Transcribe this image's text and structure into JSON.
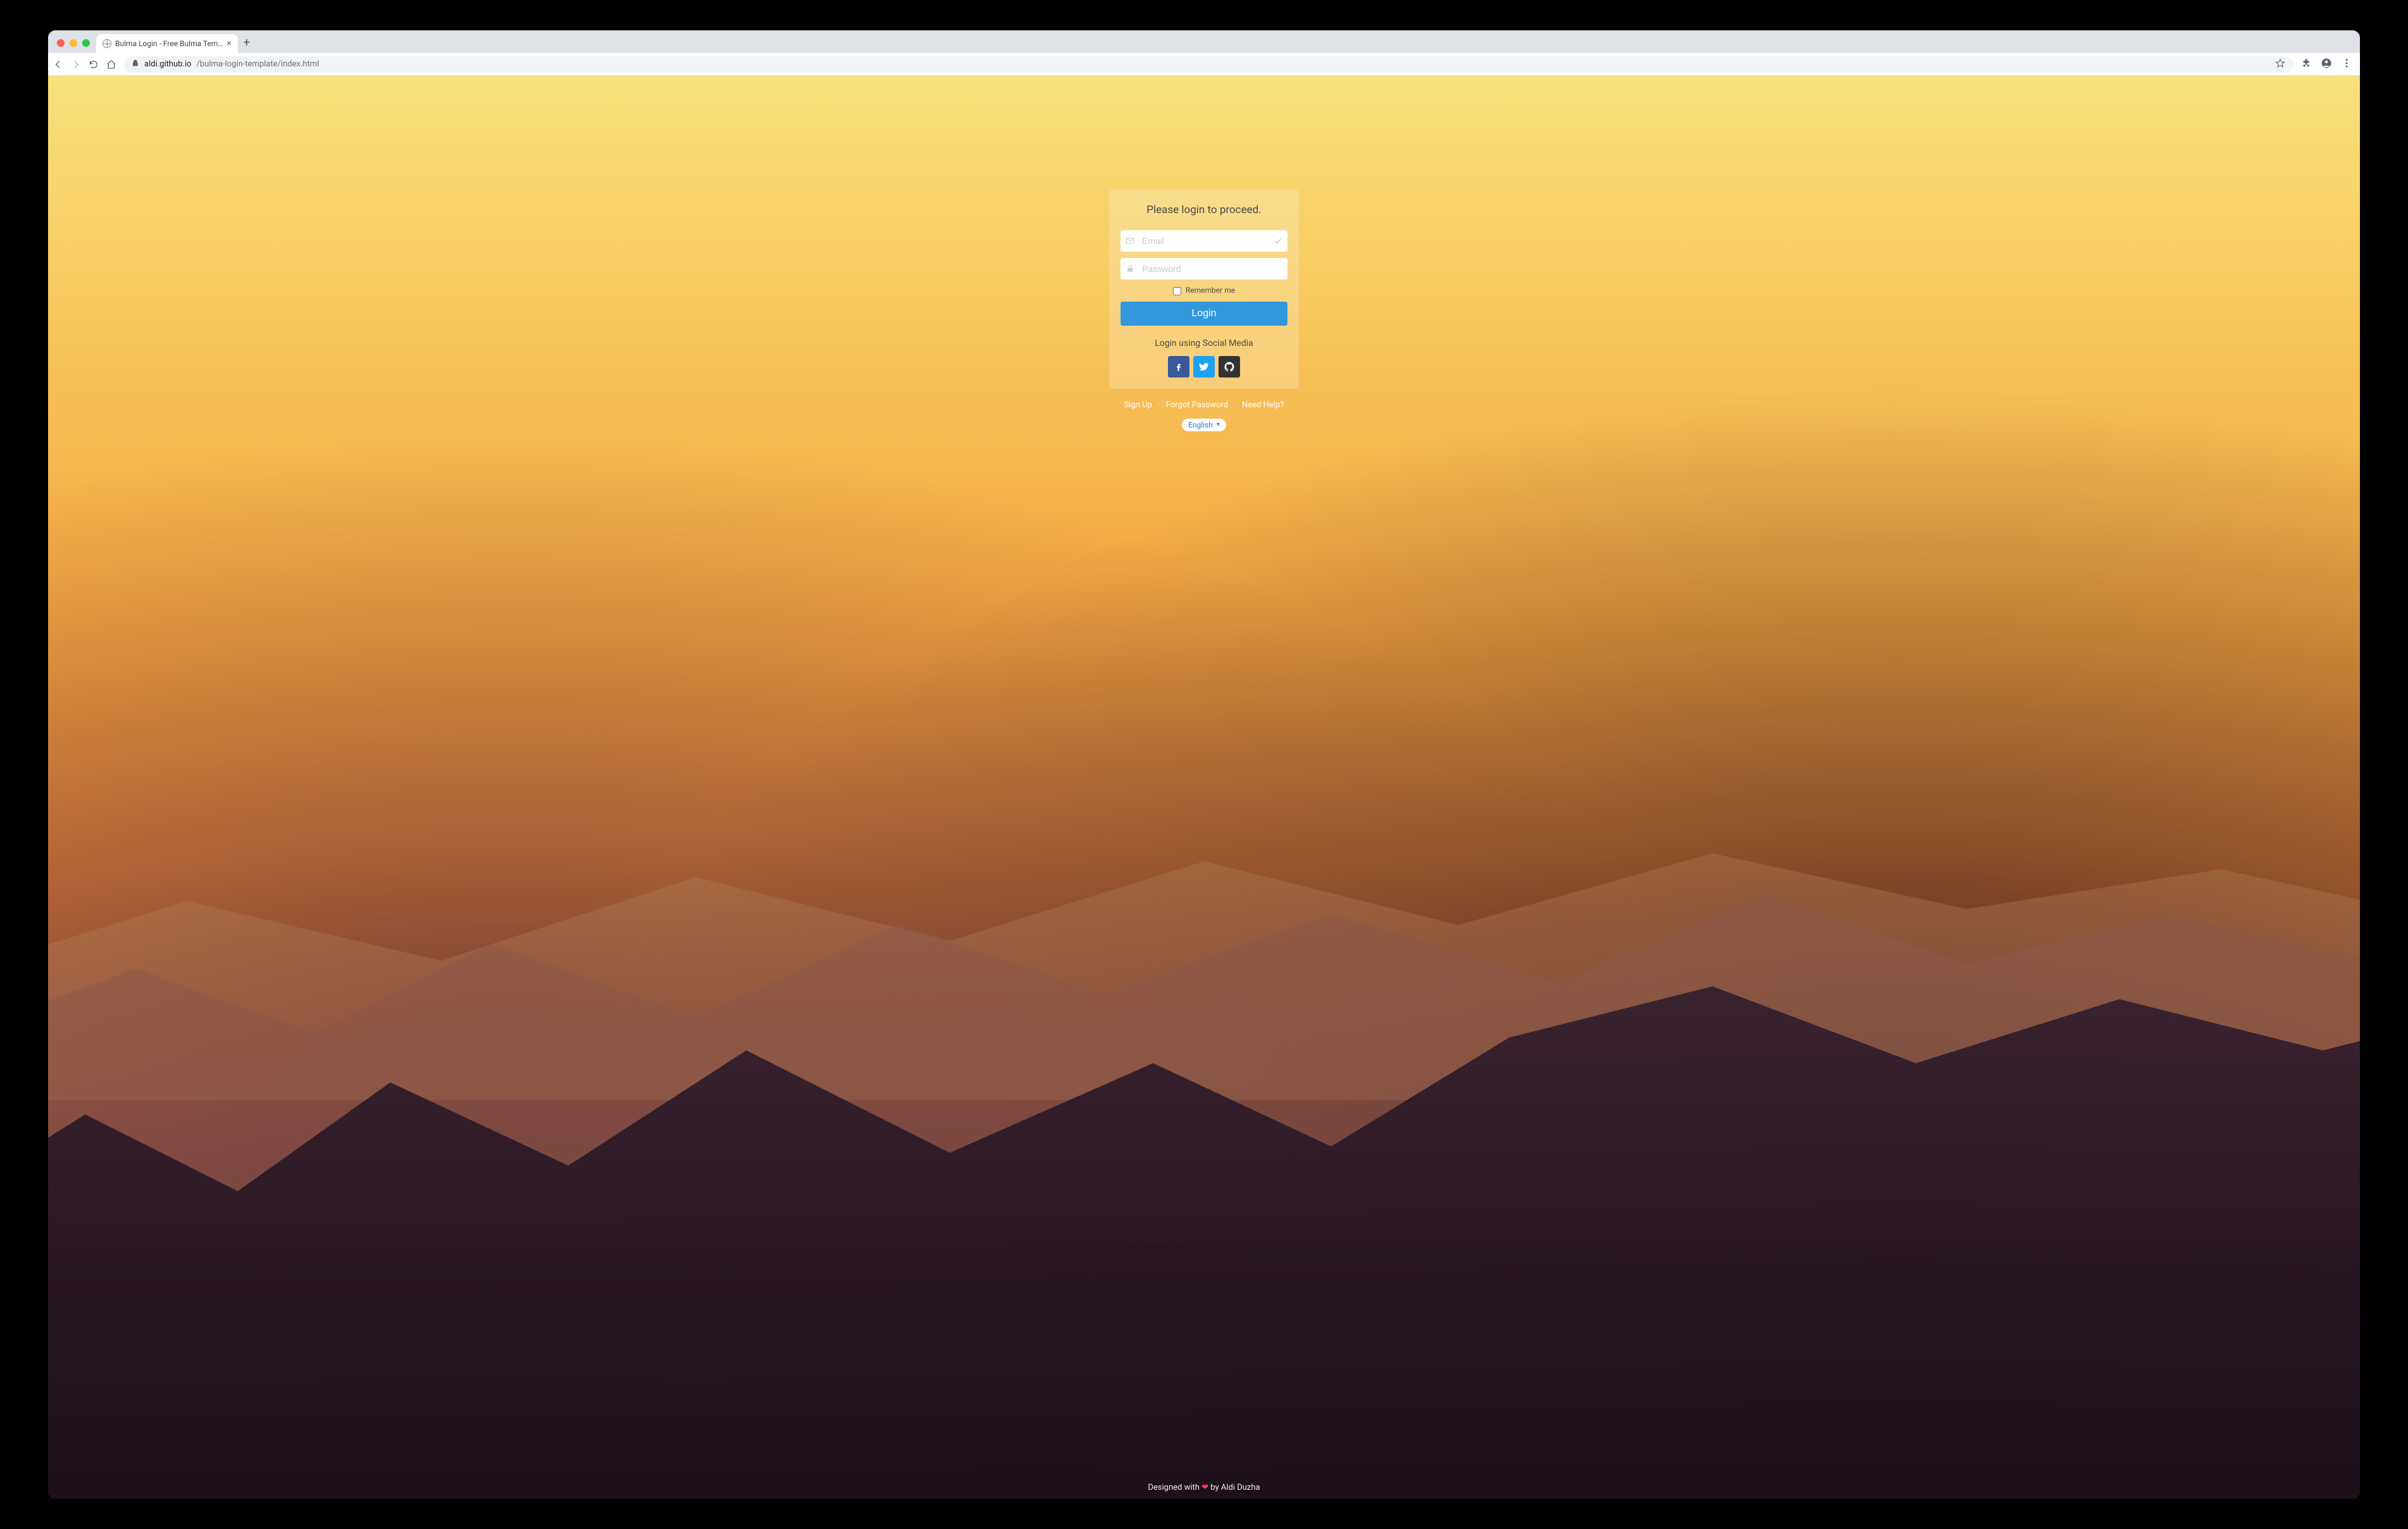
{
  "browser": {
    "tab_title": "Bulma Login - Free Bulma Tem…",
    "url_host": "aldi.github.io",
    "url_path": "/bulma-login-template/index.html"
  },
  "login": {
    "title": "Please login to proceed.",
    "email_placeholder": "Email",
    "password_placeholder": "Password",
    "remember_label": "Remember me",
    "button_label": "Login",
    "social_label": "Login using Social Media"
  },
  "links": {
    "signup": "Sign Up",
    "forgot": "Forgot Password",
    "help": "Need Help?"
  },
  "language": {
    "selected": "English"
  },
  "footer": {
    "prefix": "Designed with ",
    "suffix": " by Aldi Duzha"
  }
}
